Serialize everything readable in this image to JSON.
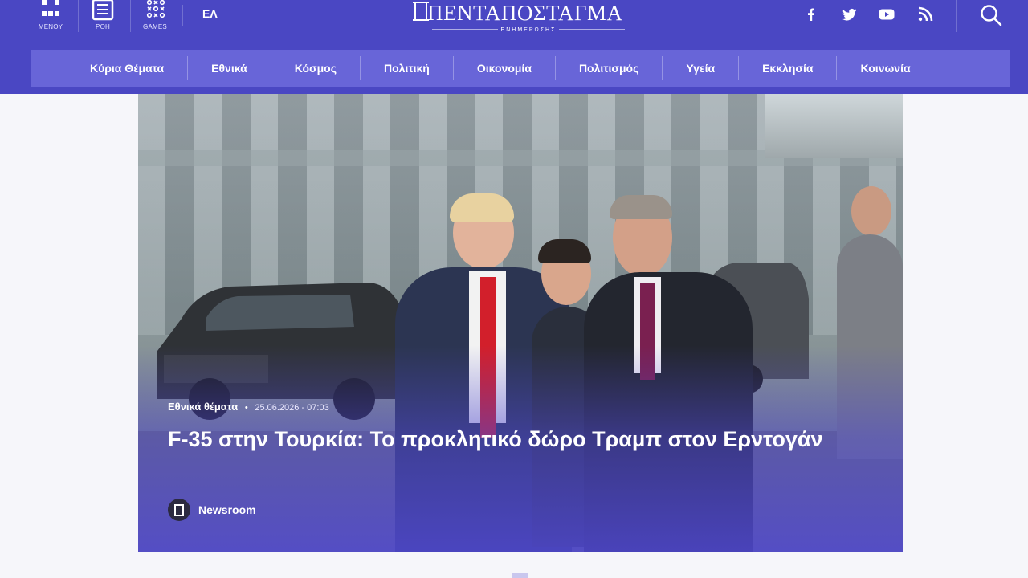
{
  "header": {
    "utility": [
      {
        "label": "MENOY",
        "icon": "menu-icon"
      },
      {
        "label": "ΡΟΗ",
        "icon": "news-feed-icon"
      },
      {
        "label": "GAMES",
        "icon": "games-icon"
      }
    ],
    "language": "ΕΛ",
    "logo": {
      "name": "ΠΕΝΤΑΠΟΣΤΑΓΜΑ",
      "tagline": "ΕΝΗΜΕΡΩΣΗΣ"
    },
    "social": [
      "facebook-icon",
      "twitter-icon",
      "youtube-icon",
      "rss-icon"
    ],
    "search_icon": "search-icon"
  },
  "nav": {
    "items": [
      "Κύρια Θέματα",
      "Εθνικά",
      "Κόσμος",
      "Πολιτική",
      "Οικονομία",
      "Πολιτισμός",
      "Υγεία",
      "Εκκλησία",
      "Κοινωνία"
    ]
  },
  "hero": {
    "category": "Εθνικά θέματα",
    "separator": "•",
    "date": "25.06.2026 - 07:03",
    "headline": "F-35 στην Τουρκία: Το προκλητικό δώρο Τραμπ στον Ερντογάν",
    "author": "Newsroom"
  },
  "colors": {
    "brand": "#4a47c3",
    "nav_bg": "#6865d8",
    "page_bg": "#f6f6fa"
  }
}
